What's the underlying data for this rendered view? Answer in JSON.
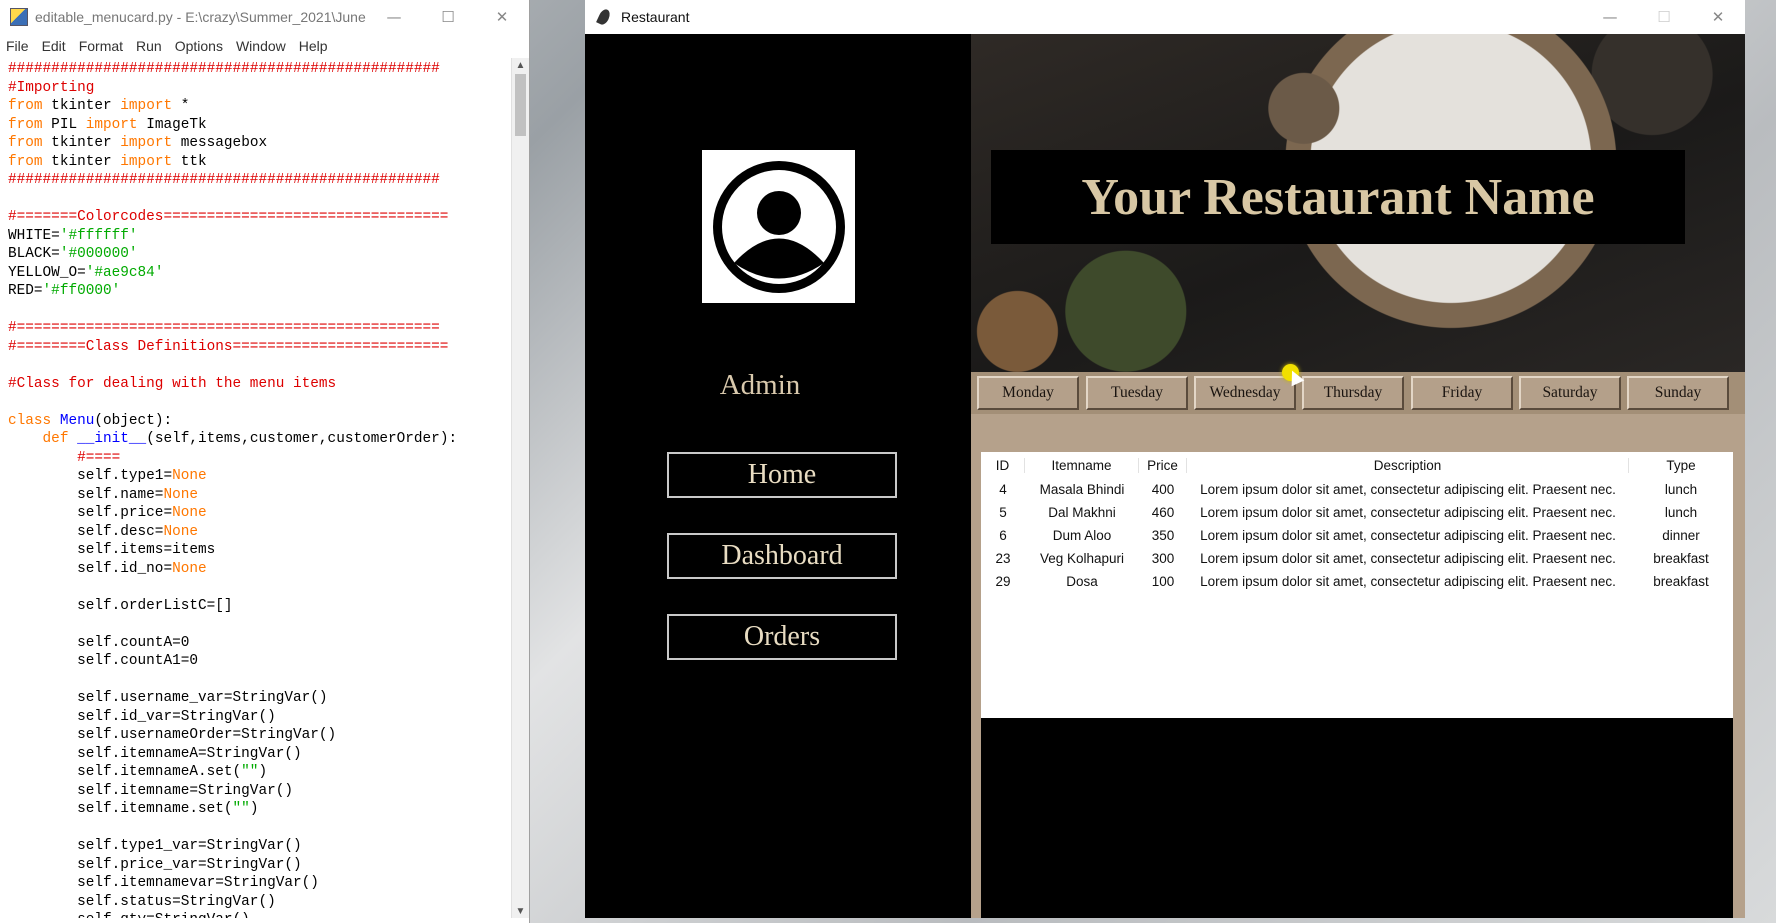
{
  "idle": {
    "title": "editable_menucard.py - E:\\crazy\\Summer_2021\\June...",
    "window_buttons": {
      "minimize": "—",
      "maximize": "☐",
      "close": "✕"
    },
    "menu": [
      "File",
      "Edit",
      "Format",
      "Run",
      "Options",
      "Window",
      "Help"
    ],
    "code_lines": [
      [
        [
          "c-comment",
          "##################################################"
        ]
      ],
      [
        [
          "c-comment",
          "#Importing"
        ]
      ],
      [
        [
          "c-kw",
          "from"
        ],
        [
          "c-plain",
          " tkinter "
        ],
        [
          "c-kw",
          "import"
        ],
        [
          "c-plain",
          " *"
        ]
      ],
      [
        [
          "c-kw",
          "from"
        ],
        [
          "c-plain",
          " PIL "
        ],
        [
          "c-kw",
          "import"
        ],
        [
          "c-plain",
          " ImageTk"
        ]
      ],
      [
        [
          "c-kw",
          "from"
        ],
        [
          "c-plain",
          " tkinter "
        ],
        [
          "c-kw",
          "import"
        ],
        [
          "c-plain",
          " messagebox"
        ]
      ],
      [
        [
          "c-kw",
          "from"
        ],
        [
          "c-plain",
          " tkinter "
        ],
        [
          "c-kw",
          "import"
        ],
        [
          "c-plain",
          " ttk"
        ]
      ],
      [
        [
          "c-comment",
          "##################################################"
        ]
      ],
      [
        [
          "c-plain",
          ""
        ]
      ],
      [
        [
          "c-comment",
          "#=======Colorcodes================================="
        ]
      ],
      [
        [
          "c-plain",
          "WHITE="
        ],
        [
          "c-str",
          "'#ffffff'"
        ]
      ],
      [
        [
          "c-plain",
          "BLACK="
        ],
        [
          "c-str",
          "'#000000'"
        ]
      ],
      [
        [
          "c-plain",
          "YELLOW_O="
        ],
        [
          "c-str",
          "'#ae9c84'"
        ]
      ],
      [
        [
          "c-plain",
          "RED="
        ],
        [
          "c-str",
          "'#ff0000'"
        ]
      ],
      [
        [
          "c-plain",
          ""
        ]
      ],
      [
        [
          "c-comment",
          "#================================================="
        ]
      ],
      [
        [
          "c-comment",
          "#========Class Definitions========================="
        ]
      ],
      [
        [
          "c-plain",
          ""
        ]
      ],
      [
        [
          "c-comment",
          "#Class for dealing with the menu items"
        ]
      ],
      [
        [
          "c-plain",
          ""
        ]
      ],
      [
        [
          "c-kw",
          "class"
        ],
        [
          "c-plain",
          " "
        ],
        [
          "c-def",
          "Menu"
        ],
        [
          "c-plain",
          "(object):"
        ]
      ],
      [
        [
          "c-plain",
          "    "
        ],
        [
          "c-kw",
          "def"
        ],
        [
          "c-plain",
          " "
        ],
        [
          "c-def",
          "__init__"
        ],
        [
          "c-plain",
          "(self,items,customer,customerOrder):"
        ]
      ],
      [
        [
          "c-plain",
          "        "
        ],
        [
          "c-comment",
          "#===="
        ]
      ],
      [
        [
          "c-plain",
          "        self.type1="
        ],
        [
          "c-kw",
          "None"
        ]
      ],
      [
        [
          "c-plain",
          "        self.name="
        ],
        [
          "c-kw",
          "None"
        ]
      ],
      [
        [
          "c-plain",
          "        self.price="
        ],
        [
          "c-kw",
          "None"
        ]
      ],
      [
        [
          "c-plain",
          "        self.desc="
        ],
        [
          "c-kw",
          "None"
        ]
      ],
      [
        [
          "c-plain",
          "        self.items=items"
        ]
      ],
      [
        [
          "c-plain",
          "        self.id_no="
        ],
        [
          "c-kw",
          "None"
        ]
      ],
      [
        [
          "c-plain",
          ""
        ]
      ],
      [
        [
          "c-plain",
          "        self.orderListC=[]"
        ]
      ],
      [
        [
          "c-plain",
          ""
        ]
      ],
      [
        [
          "c-plain",
          "        self.countA=0"
        ]
      ],
      [
        [
          "c-plain",
          "        self.countA1=0"
        ]
      ],
      [
        [
          "c-plain",
          ""
        ]
      ],
      [
        [
          "c-plain",
          "        self.username_var=StringVar()"
        ]
      ],
      [
        [
          "c-plain",
          "        self.id_var=StringVar()"
        ]
      ],
      [
        [
          "c-plain",
          "        self.usernameOrder=StringVar()"
        ]
      ],
      [
        [
          "c-plain",
          "        self.itemnameA=StringVar()"
        ]
      ],
      [
        [
          "c-plain",
          "        self.itemnameA.set("
        ],
        [
          "c-str",
          "\"\""
        ],
        [
          "c-plain",
          ")"
        ]
      ],
      [
        [
          "c-plain",
          "        self.itemname=StringVar()"
        ]
      ],
      [
        [
          "c-plain",
          "        self.itemname.set("
        ],
        [
          "c-str",
          "\"\""
        ],
        [
          "c-plain",
          ")"
        ]
      ],
      [
        [
          "c-plain",
          ""
        ]
      ],
      [
        [
          "c-plain",
          "        self.type1_var=StringVar()"
        ]
      ],
      [
        [
          "c-plain",
          "        self.price_var=StringVar()"
        ]
      ],
      [
        [
          "c-plain",
          "        self.itemnamevar=StringVar()"
        ]
      ],
      [
        [
          "c-plain",
          "        self.status=StringVar()"
        ]
      ],
      [
        [
          "c-plain",
          "        self.qty=StringVar()"
        ]
      ]
    ]
  },
  "restaurant": {
    "title": "Restaurant",
    "window_buttons": {
      "minimize": "—",
      "maximize": "☐",
      "close": "✕"
    },
    "sidebar": {
      "username": "Admin",
      "nav": [
        "Home",
        "Dashboard",
        "Orders"
      ]
    },
    "banner_title": "Your Restaurant Name",
    "days": [
      "Monday",
      "Tuesday",
      "Wednesday",
      "Thursday",
      "Friday",
      "Saturday",
      "Sunday"
    ],
    "table": {
      "columns": [
        "ID",
        "Itemname",
        "Price",
        "Description",
        "Type"
      ],
      "rows": [
        [
          "4",
          "Masala Bhindi",
          "400",
          "Lorem ipsum dolor sit amet, consectetur adipiscing elit. Praesent nec.",
          "lunch"
        ],
        [
          "5",
          "Dal Makhni",
          "460",
          "Lorem ipsum dolor sit amet, consectetur adipiscing elit. Praesent nec.",
          "lunch"
        ],
        [
          "6",
          "Dum Aloo",
          "350",
          "Lorem ipsum dolor sit amet, consectetur adipiscing elit. Praesent nec.",
          "dinner"
        ],
        [
          "23",
          "Veg Kolhapuri",
          "300",
          "Lorem ipsum dolor sit amet, consectetur adipiscing elit. Praesent nec.",
          "breakfast"
        ],
        [
          "29",
          "Dosa",
          "100",
          "Lorem ipsum dolor sit amet, consectetur adipiscing elit. Praesent nec.",
          "breakfast"
        ]
      ]
    },
    "colors": {
      "accent": "#ae9c84",
      "background": "#000000",
      "text": "#ffffff"
    }
  }
}
